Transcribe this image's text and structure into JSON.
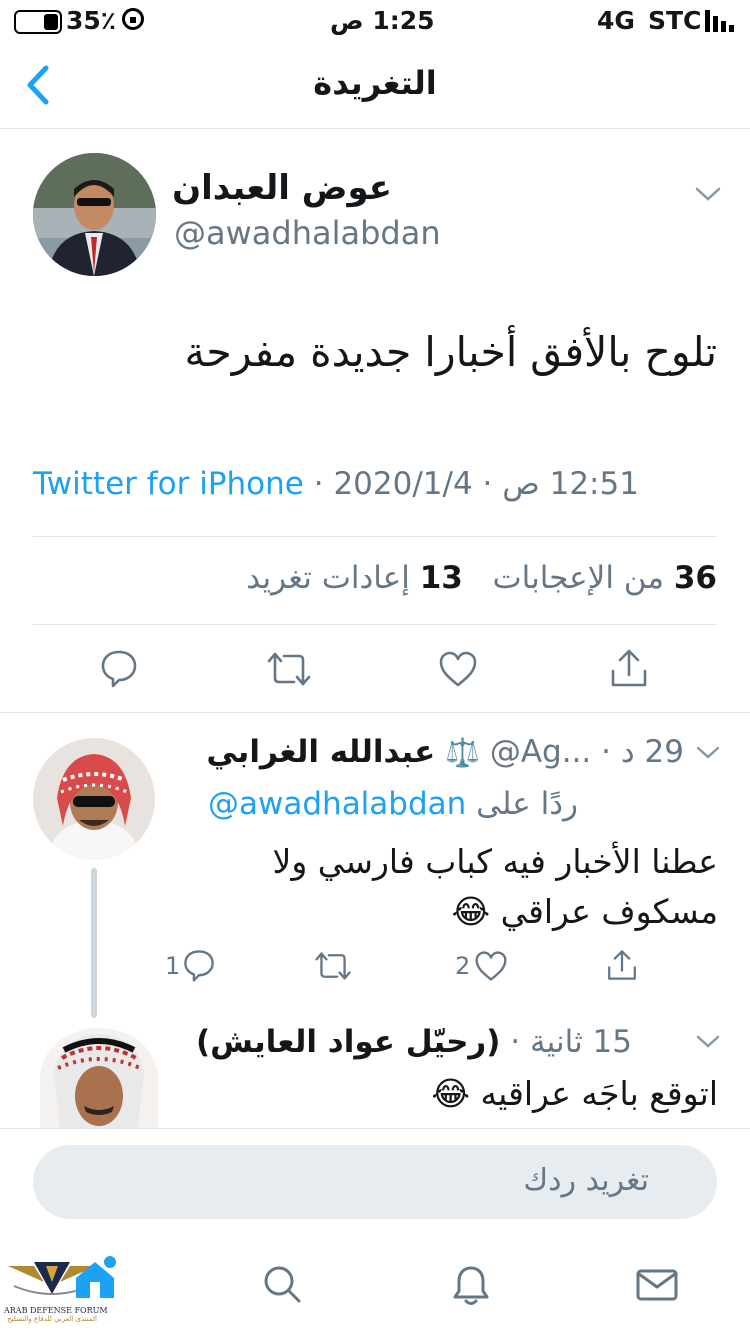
{
  "status_bar": {
    "battery_percent": "35٪",
    "time": "1:25 ص",
    "network": "4G",
    "carrier": "STC"
  },
  "nav": {
    "title": "التغريدة"
  },
  "tweet": {
    "author_name": "عوض العبدان",
    "handle": "@awadhalabdan",
    "text": "تلوح بالأفق أخبارا جديدة مفرحة",
    "source": "Twitter for iPhone",
    "sep": "·",
    "date": "2020/1/4",
    "time": "12:51 ص",
    "likes_count": "36",
    "likes_label": "من الإعجابات",
    "retweets_count": "13",
    "retweets_label": "إعادات تغريد"
  },
  "replies": [
    {
      "name": "عبدالله  الغرابي",
      "badge": "⚖️",
      "handle": "@Ag...",
      "age": "29 د",
      "replying_to_label": "ردًا على",
      "replying_to_handle": "@awadhalabdan",
      "line1": "عطنا الأخبار فيه كباب فارسي ولا",
      "line2": "مسكوف عراقي 😂",
      "reply_count": "1",
      "like_count": "2"
    },
    {
      "name": "(رحيّل عواد العايش)",
      "age": "15 ثانية",
      "text": "اتوقع باجَه عراقيه 😂"
    }
  ],
  "compose": {
    "placeholder": "تغريد ردك"
  },
  "watermark": {
    "line1": "ARAB DEFENSE FORUM",
    "line2": "المنتدى العربي للدفاع والتسليح"
  },
  "colors": {
    "accent": "#1da1f2",
    "text": "#14171a",
    "secondary": "#657786",
    "divider": "#e1e8ed"
  }
}
